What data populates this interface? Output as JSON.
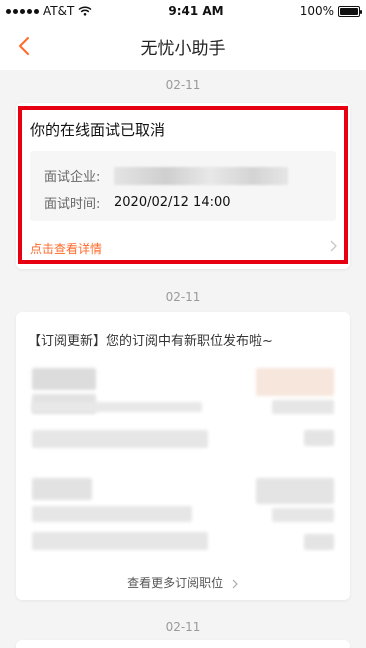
{
  "status_bar": {
    "carrier": "AT&T",
    "time": "9:41 AM",
    "battery": "100%"
  },
  "nav": {
    "title": "无忧小助手"
  },
  "messages": [
    {
      "date": "02-11",
      "title": "你的在线面试已取消",
      "fields": [
        {
          "label": "面试企业:",
          "value": ""
        },
        {
          "label": "面试时间:",
          "value": "2020/02/12 14:00"
        }
      ],
      "link": "点击查看详情"
    },
    {
      "date": "02-11",
      "title": "【订阅更新】您的订阅中有新职位发布啦~",
      "link": "查看更多订阅职位"
    },
    {
      "date": "02-11"
    }
  ],
  "colors": {
    "accent": "#ff6a2b",
    "highlight": "#e60012",
    "background": "#f4f4f4"
  }
}
